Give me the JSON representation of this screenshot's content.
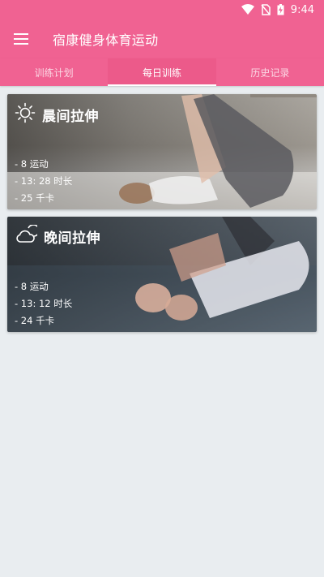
{
  "status_bar": {
    "time": "9:44",
    "icons": [
      "wifi-icon",
      "no-sim-icon",
      "battery-charging-icon"
    ]
  },
  "app_bar": {
    "title": "宿康健身体育运动",
    "menu_icon": "hamburger-menu-icon"
  },
  "tabs": [
    {
      "label": "训练计划",
      "active": false
    },
    {
      "label": "每日训练",
      "active": true
    },
    {
      "label": "历史记录",
      "active": false
    }
  ],
  "cards": [
    {
      "icon": "sun-icon",
      "title": "晨间拉伸",
      "stats": [
        "- 8 运动",
        "- 13: 28 时长",
        "- 25 千卡"
      ]
    },
    {
      "icon": "cloud-moon-icon",
      "title": "晚间拉伸",
      "stats": [
        "- 8 运动",
        "- 13: 12 时长",
        "- 24 千卡"
      ]
    }
  ],
  "colors": {
    "primary": "#f06292",
    "background": "#e9edf0",
    "text_on_primary": "#ffffff"
  }
}
